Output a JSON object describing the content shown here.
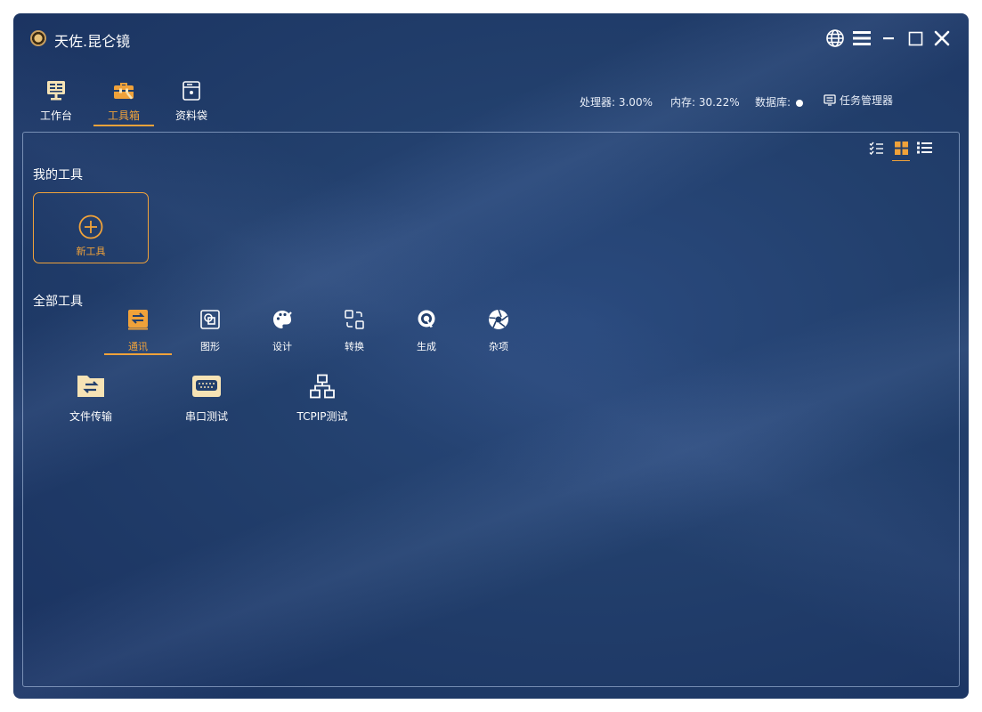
{
  "app": {
    "title": "天佐.昆仑镜"
  },
  "window_controls": [
    "globe-icon",
    "menu-icon",
    "minimize-icon",
    "maximize-icon",
    "close-icon"
  ],
  "tabs": [
    {
      "label": "工作台",
      "icon": "workbench-icon",
      "active": false
    },
    {
      "label": "工具箱",
      "icon": "toolbox-icon",
      "active": true
    },
    {
      "label": "资料袋",
      "icon": "folder-bag-icon",
      "active": false
    }
  ],
  "status": {
    "cpu": "处理器: 3.00%",
    "memory": "内存: 30.22%",
    "database": "数据库:",
    "task_manager": "任务管理器"
  },
  "view_modes": [
    {
      "icon": "checklist-icon",
      "active": false
    },
    {
      "icon": "grid-icon",
      "active": true
    },
    {
      "icon": "list-icon",
      "active": false
    }
  ],
  "my_tools": {
    "title": "我的工具",
    "new_tool_label": "新工具"
  },
  "all_tools": {
    "title": "全部工具",
    "categories": [
      {
        "label": "通讯",
        "icon": "communication-icon",
        "active": true
      },
      {
        "label": "图形",
        "icon": "graphics-icon",
        "active": false
      },
      {
        "label": "设计",
        "icon": "palette-icon",
        "active": false
      },
      {
        "label": "转换",
        "icon": "convert-icon",
        "active": false
      },
      {
        "label": "生成",
        "icon": "generate-icon",
        "active": false
      },
      {
        "label": "杂项",
        "icon": "aperture-icon",
        "active": false
      }
    ],
    "tools": [
      {
        "label": "文件传输",
        "icon": "file-transfer-icon"
      },
      {
        "label": "串口测试",
        "icon": "serial-port-icon"
      },
      {
        "label": "TCPIP测试",
        "icon": "network-icon"
      }
    ]
  },
  "colors": {
    "accent": "#f0a23a",
    "background": "#223f6c",
    "text": "#ffffff"
  }
}
